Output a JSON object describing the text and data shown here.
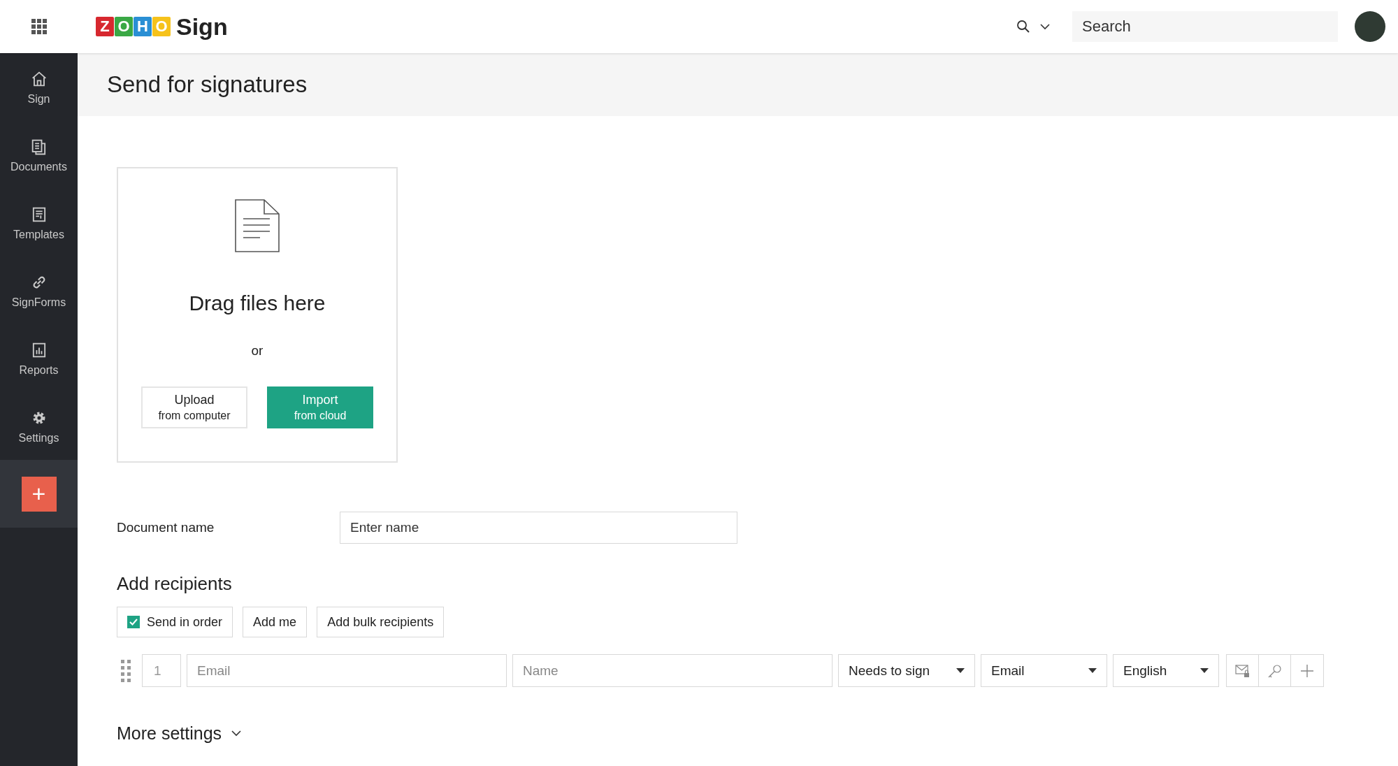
{
  "top_bar": {
    "logo_letters": [
      "Z",
      "O",
      "H",
      "O"
    ],
    "product": "Sign",
    "search": {
      "placeholder": "Search"
    }
  },
  "sidebar": {
    "items": [
      {
        "label": "Sign",
        "selected": false
      },
      {
        "label": "Documents",
        "selected": false
      },
      {
        "label": "Templates",
        "selected": false
      },
      {
        "label": "SignForms",
        "selected": false
      },
      {
        "label": "Reports",
        "selected": false
      },
      {
        "label": "Settings",
        "selected": false
      }
    ],
    "new_button": "+"
  },
  "page_title": "Send for signatures",
  "upload": {
    "heading": "Drag files here",
    "separator": "or",
    "buttons": [
      {
        "title": "Upload",
        "subtitle": "from computer",
        "kind": "outline"
      },
      {
        "title": "Import",
        "subtitle": "from cloud",
        "kind": "primary"
      }
    ]
  },
  "document_name": {
    "label": "Document name",
    "placeholder": "Enter name"
  },
  "recipients": {
    "heading": "Add recipients",
    "send_in_order": {
      "label": "Send in order",
      "checked": true
    },
    "buttons": [
      "Add me",
      "Add bulk recipients"
    ],
    "rows": [
      {
        "order": "1",
        "email_placeholder": "Email",
        "name_placeholder": "Name",
        "action": "Needs to sign",
        "delivery": "Email",
        "language": "English"
      }
    ]
  },
  "more_settings": "More settings"
}
